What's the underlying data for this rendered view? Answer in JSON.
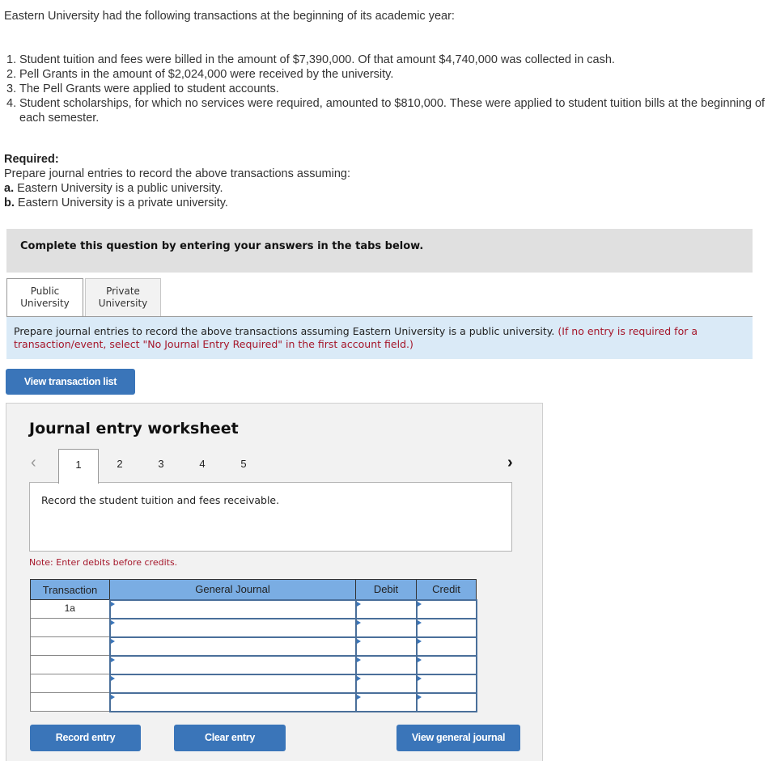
{
  "problem": {
    "intro": "Eastern University had the following transactions at the beginning of its academic year:",
    "transactions": [
      {
        "num": "1.",
        "text": "Student tuition and fees were billed in the amount of $7,390,000. Of that amount $4,740,000 was collected in cash."
      },
      {
        "num": "2.",
        "text": "Pell Grants in the amount of $2,024,000 were received by the university."
      },
      {
        "num": "3.",
        "text": "The Pell Grants were applied to student accounts."
      },
      {
        "num": "4.",
        "text": "Student scholarships, for which no services were required, amounted to $810,000. These were applied to student tuition bills at the beginning of each semester."
      }
    ],
    "required_title": "Required:",
    "required_text": "Prepare journal entries to record the above transactions assuming:",
    "parts": [
      {
        "letter": "a.",
        "text": " Eastern University is a public university."
      },
      {
        "letter": "b.",
        "text": " Eastern University is a private university."
      }
    ]
  },
  "banner": "Complete this question by entering your answers in the tabs below.",
  "tabs": [
    {
      "label_line1": "Public",
      "label_line2": "University",
      "active": true
    },
    {
      "label_line1": "Private",
      "label_line2": "University",
      "active": false
    }
  ],
  "instructions": {
    "main": "Prepare journal entries to record the above transactions assuming Eastern University is a public university.",
    "note": "(If no entry is required for a transaction/event, select \"No Journal Entry Required\" in the first account field.)"
  },
  "buttons": {
    "view_transaction_list": "View transaction list",
    "record_entry": "Record entry",
    "clear_entry": "Clear entry",
    "view_general_journal": "View general journal"
  },
  "worksheet": {
    "title": "Journal entry worksheet",
    "prev_icon": "chevron-left-icon",
    "next_icon": "chevron-right-icon",
    "steps": [
      "1",
      "2",
      "3",
      "4",
      "5"
    ],
    "active_step": "1",
    "description": "Record the student tuition and fees receivable.",
    "note": "Note: Enter debits before credits.",
    "table": {
      "headers": [
        "Transaction",
        "General Journal",
        "Debit",
        "Credit"
      ],
      "rows": [
        {
          "transaction": "1a",
          "account": "",
          "debit": "",
          "credit": ""
        },
        {
          "transaction": "",
          "account": "",
          "debit": "",
          "credit": ""
        },
        {
          "transaction": "",
          "account": "",
          "debit": "",
          "credit": ""
        },
        {
          "transaction": "",
          "account": "",
          "debit": "",
          "credit": ""
        },
        {
          "transaction": "",
          "account": "",
          "debit": "",
          "credit": ""
        },
        {
          "transaction": "",
          "account": "",
          "debit": "",
          "credit": ""
        }
      ]
    }
  }
}
